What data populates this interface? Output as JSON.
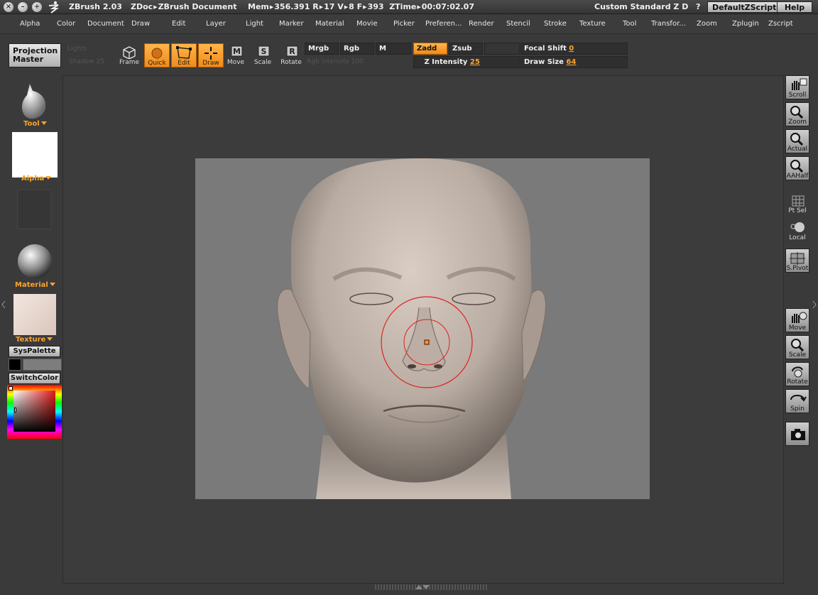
{
  "titlebar": {
    "app": "ZBrush 2.03",
    "doc": "ZDoc",
    "doc_name": "ZBrush Document",
    "mem_label": "Mem",
    "mem_value": "356.391",
    "r_label": "R",
    "r_value": "17",
    "v_label": "V",
    "v_value": "8",
    "f_label": "F",
    "f_value": "393",
    "ztime_label": "ZTime",
    "ztime_value": "00:07:02.07",
    "layout": "Custom  Standard  Z  D",
    "question": "?",
    "script_button": "DefaultZScript",
    "help_button": "Help"
  },
  "menu": [
    "Alpha",
    "Color",
    "Document",
    "Draw",
    "Edit",
    "Layer",
    "Light",
    "Marker",
    "Material",
    "Movie",
    "Picker",
    "Preferen...",
    "Render",
    "Stencil",
    "Stroke",
    "Texture",
    "Tool",
    "Transfor...",
    "Zoom",
    "Zplugin",
    "Zscript"
  ],
  "toolbar": {
    "projection_master": [
      "Projection",
      "Master"
    ],
    "disabled1": "Lights",
    "disabled2": "Shadow 25",
    "frame": "Frame",
    "quick": "Quick",
    "edit": "Edit",
    "draw": "Draw",
    "move": "Move",
    "scale": "Scale",
    "rotate": "Rotate",
    "mrgb": "Mrgb",
    "rgb": "Rgb",
    "m": "M",
    "zadd": "Zadd",
    "zsub": "Zsub",
    "rgb_intensity": "Rgb Intensity 100",
    "z_intensity_label": "Z Intensity",
    "z_intensity_value": "25",
    "focal_shift_label": "Focal Shift",
    "focal_shift_value": "0",
    "draw_size_label": "Draw Size",
    "draw_size_value": "64"
  },
  "leftpanel": {
    "tool": "Tool",
    "alpha": "Alpha",
    "material": "Material",
    "texture": "Texture",
    "syspalette": "SysPalette",
    "switchcolor": "SwitchColor"
  },
  "rightpanel": [
    "Scroll",
    "Zoom",
    "Actual",
    "AAHalf",
    "Pt Sel",
    "Local",
    "S.Pivot",
    "Move",
    "Scale",
    "Rotate",
    "Spin"
  ],
  "colors": {
    "accent": "#f39322",
    "bg": "#3a3a3a",
    "canvas_bg": "#7a7a7a",
    "brush_ring": "#e02020"
  }
}
